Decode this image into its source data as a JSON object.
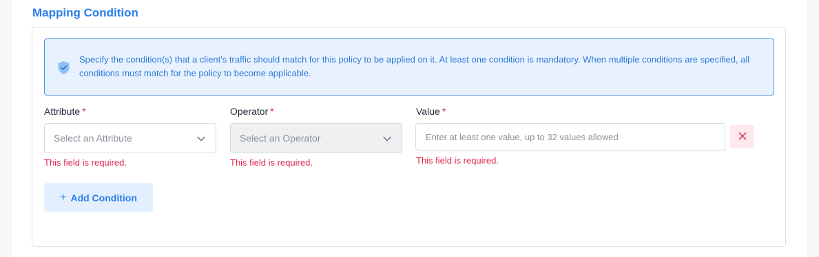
{
  "section": {
    "title": "Mapping Condition"
  },
  "info": {
    "icon": "shield-check-icon",
    "text": "Specify the condition(s) that a client's traffic should match for this policy to be applied on it. At least one condition is mandatory. When multiple conditions are specified, all conditions must match for the policy to become applicable."
  },
  "fields": {
    "attribute": {
      "label": "Attribute",
      "required_mark": "*",
      "placeholder": "Select an Attribute",
      "error": "This field is required."
    },
    "operator": {
      "label": "Operator",
      "required_mark": "*",
      "placeholder": "Select an Operator",
      "error": "This field is required.",
      "disabled": true
    },
    "value": {
      "label": "Value",
      "required_mark": "*",
      "placeholder": "Enter at least one value, up to 32 values allowed",
      "value": "",
      "error": "This field is required."
    }
  },
  "actions": {
    "delete_icon": "close-icon",
    "add_label": "Add Condition",
    "add_symbol": "+"
  },
  "colors": {
    "accent": "#2b7de9",
    "error": "#e0244a",
    "info_bg": "#e8f2fe"
  }
}
